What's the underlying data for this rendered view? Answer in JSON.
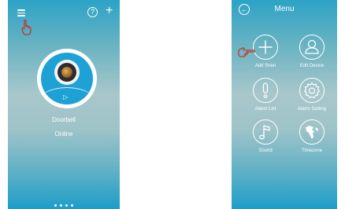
{
  "left_screen": {
    "device": {
      "name": "Doorbell",
      "status": "Online"
    },
    "header": {
      "menu_icon": "hamburger-icon",
      "help_icon": "question-circle-icon",
      "help_glyph": "?",
      "add_icon": "plus-icon",
      "add_glyph": "+"
    },
    "page_indicator": {
      "count": 4
    }
  },
  "right_screen": {
    "header": {
      "title": "Menu",
      "back_icon": "back-arrow-icon",
      "back_glyph": "←"
    },
    "items": [
      {
        "label": "Add Siren",
        "icon": "plus-icon"
      },
      {
        "label": "Edit Device",
        "icon": "user-icon"
      },
      {
        "label": "Alarm List",
        "icon": "alert-icon"
      },
      {
        "label": "Alarm Setting",
        "icon": "gear-icon"
      },
      {
        "label": "Sound",
        "icon": "music-note-icon"
      },
      {
        "label": "Timezone",
        "icon": "globe-icon"
      }
    ]
  },
  "colors": {
    "accent": "#1ea2d6",
    "pointer": "#c0392b",
    "text": "#ffffff"
  }
}
